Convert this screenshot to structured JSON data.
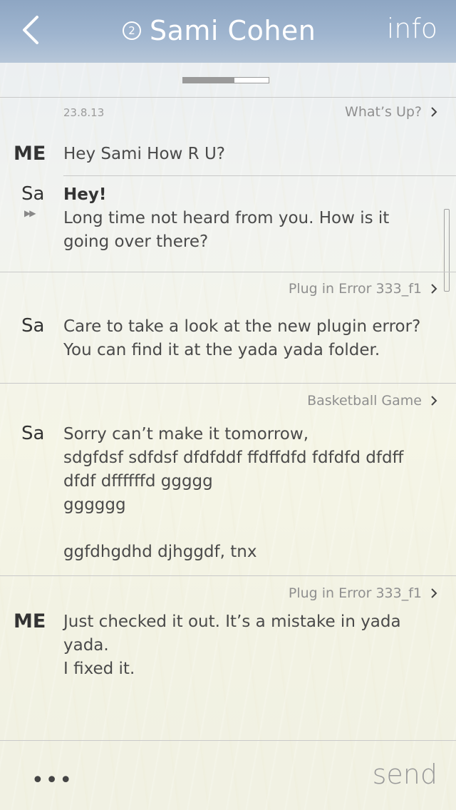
{
  "header": {
    "count": "2",
    "title": "Sami Cohen",
    "info_label": "info"
  },
  "loading": {
    "progress": 0.6
  },
  "colors": {
    "header_bg": "#9fb5cf",
    "text": "#333333",
    "muted": "#9a9a9a"
  },
  "threads": [
    {
      "date": "23.8.13",
      "subject": "What’s Up?",
      "messages": [
        {
          "sender": "ME",
          "text": "Hey Sami How R U?"
        },
        {
          "sender": "Sa",
          "bold": "Hey!",
          "text": "Long time not heard from you. How is it\ngoing over there?"
        }
      ]
    },
    {
      "subject": "Plug in Error 333_f1",
      "messages": [
        {
          "sender": "Sa",
          "text": "Care to take a look at the new plugin error?\nYou can find it at the yada yada folder."
        }
      ]
    },
    {
      "subject": "Basketball Game",
      "messages": [
        {
          "sender": "Sa",
          "text": "Sorry can’t make it tomorrow,\nsdgfdsf sdfdsf dfdfddf ffdffdfd fdfdfd dfdff\ndfdf dffffffd ggggg\ngggggg\n\nggfdhgdhd djhggdf, tnx"
        }
      ]
    },
    {
      "subject": "Plug in Error 333_f1",
      "messages": [
        {
          "sender": "ME",
          "text": "Just checked it out. It’s a mistake in yada\nyada.\nI fixed it."
        }
      ]
    }
  ],
  "footer": {
    "more_label": "•••",
    "send_label": "send"
  }
}
